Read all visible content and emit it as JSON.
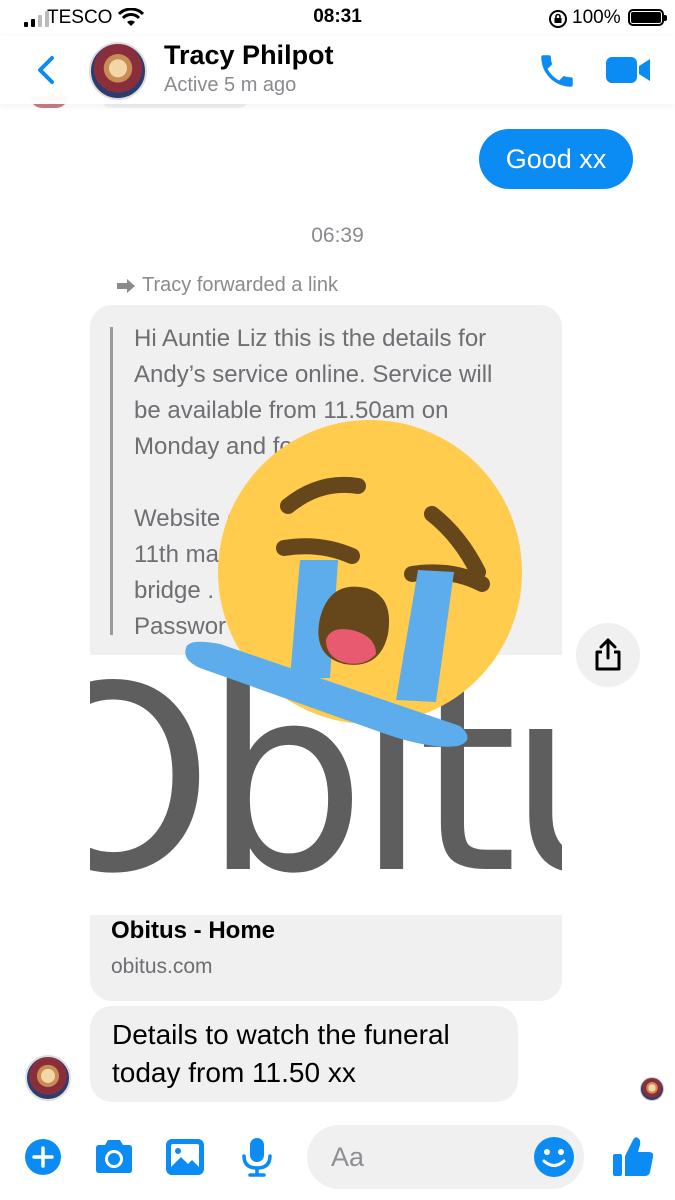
{
  "status_bar": {
    "carrier": "TESCO",
    "time": "08:31",
    "battery": "100%"
  },
  "header": {
    "contact_name": "Tracy Philpot",
    "contact_status": "Active 5 m ago"
  },
  "chat": {
    "outgoing_message": "Good xx",
    "timestamp": "06:39",
    "forward_note": "Tracy forwarded a link",
    "link_card": {
      "quote_text": "Hi Auntie Liz this is the details for\nAndy’s service online.  Service will\nbe available from 11.50am on\nMonday and fo\n\nWebsite                               ce\n11th ma\nbridge .\nPasswor",
      "image_logo_text": "Obitus",
      "title": "Obitus - Home",
      "domain": "obitus.com"
    },
    "incoming_message": "Details to watch the funeral today from 11.50 xx"
  },
  "composer": {
    "placeholder": "Aa"
  },
  "colors": {
    "accent": "#0a8cf4",
    "bubble_grey": "#f0f0f0",
    "emoji_face": "#ffcc4d",
    "emoji_tears": "#5dadec"
  },
  "icons": [
    "back-chevron-icon",
    "phone-icon",
    "video-camera-icon",
    "forward-arrow-icon",
    "share-icon",
    "plus-icon",
    "camera-icon",
    "image-icon",
    "microphone-icon",
    "smiley-icon",
    "thumbs-up-icon",
    "loudly-crying-face-emoji"
  ]
}
